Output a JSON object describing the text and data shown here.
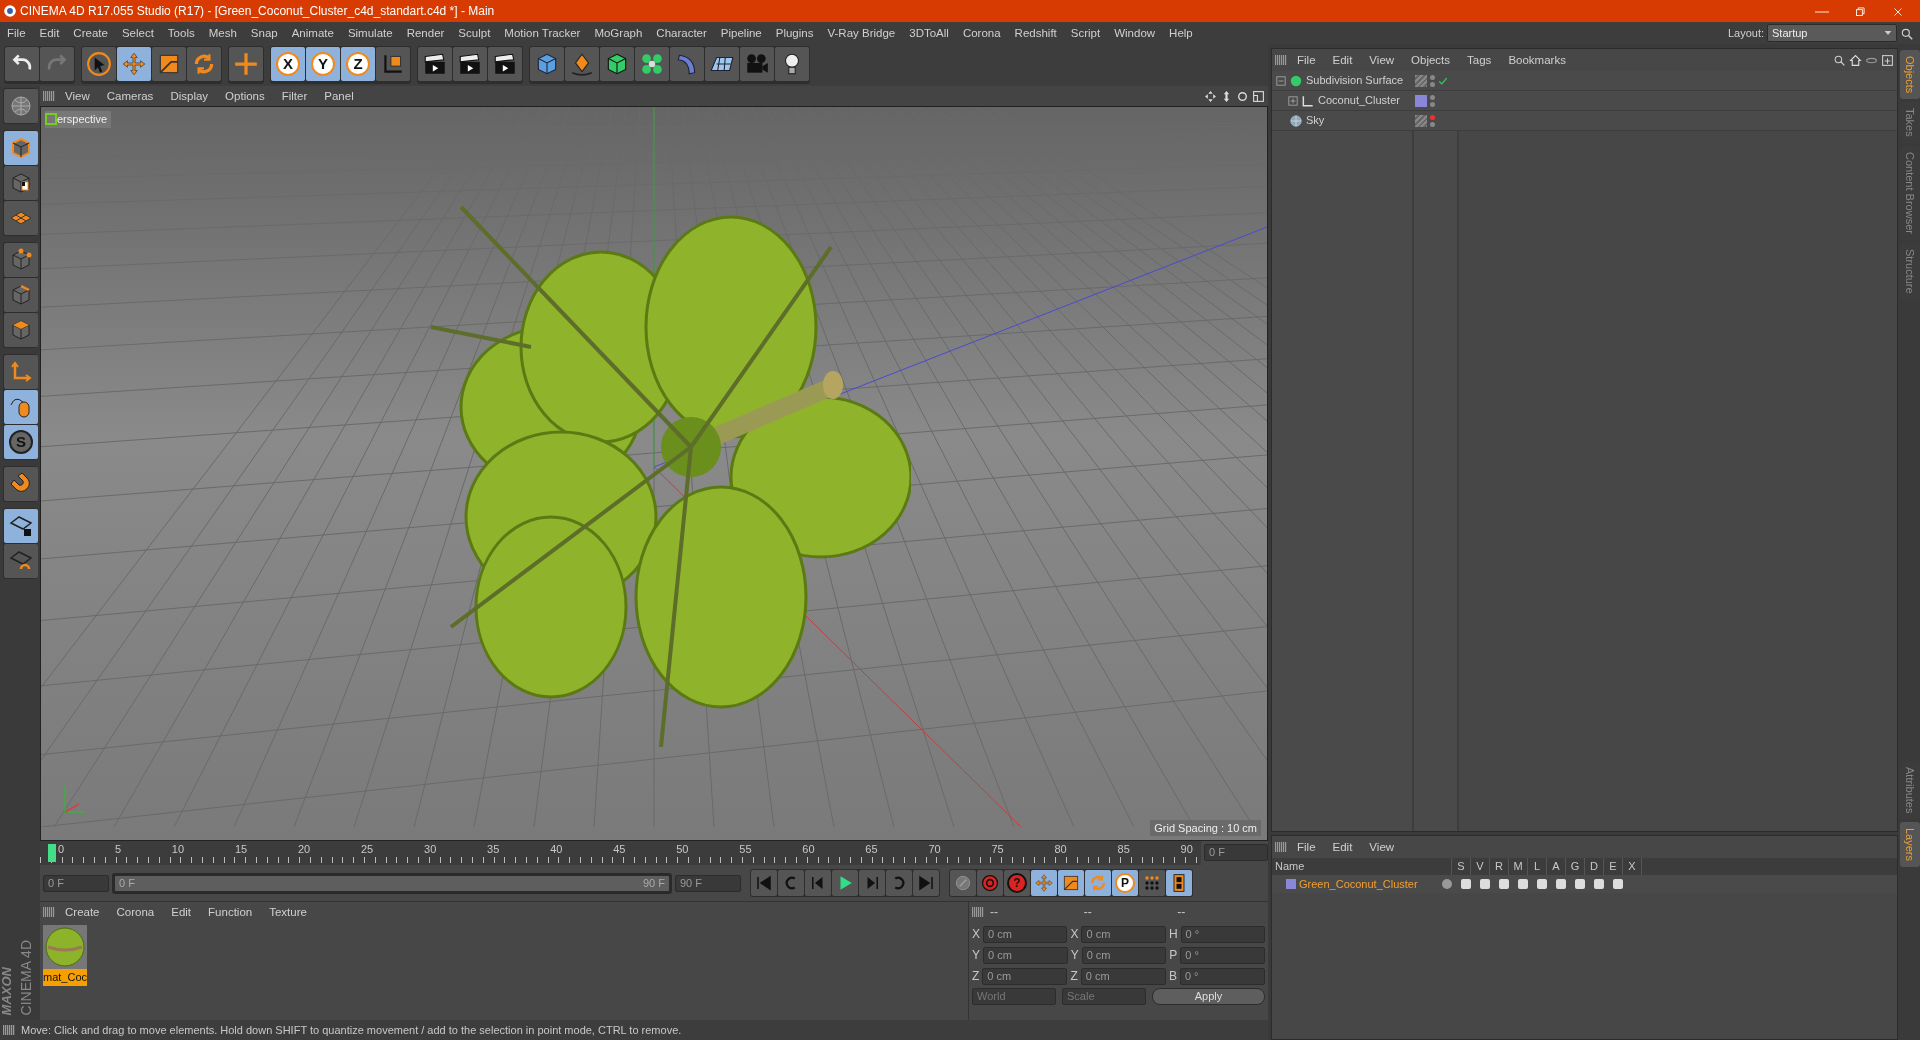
{
  "window": {
    "title": "CINEMA 4D R17.055 Studio (R17) - [Green_Coconut_Cluster_c4d_standart.c4d *] - Main"
  },
  "menu": [
    "File",
    "Edit",
    "Create",
    "Select",
    "Tools",
    "Mesh",
    "Snap",
    "Animate",
    "Simulate",
    "Render",
    "Sculpt",
    "Motion Tracker",
    "MoGraph",
    "Character",
    "Pipeline",
    "Plugins",
    "V-Ray Bridge",
    "3DToAll",
    "Corona",
    "Redshift",
    "Script",
    "Window",
    "Help"
  ],
  "layout": {
    "label": "Layout:",
    "value": "Startup"
  },
  "toolbar": [
    [
      {
        "kind": "undo",
        "selected": false
      },
      {
        "kind": "redo",
        "selected": false
      }
    ],
    [
      {
        "kind": "pointer",
        "selected": false
      },
      {
        "kind": "move",
        "selected": true
      },
      {
        "kind": "scale",
        "selected": false
      },
      {
        "kind": "rotate",
        "selected": false
      }
    ],
    [
      {
        "kind": "multi",
        "selected": false
      }
    ],
    [
      {
        "kind": "axis",
        "label": "X",
        "selected": true
      },
      {
        "kind": "axis",
        "label": "Y",
        "selected": true
      },
      {
        "kind": "axis",
        "label": "Z",
        "selected": true
      },
      {
        "kind": "coord",
        "selected": false
      }
    ],
    [
      {
        "kind": "clapper",
        "selected": false
      },
      {
        "kind": "clapper",
        "selected": false
      },
      {
        "kind": "clapper",
        "selected": false
      }
    ],
    [
      {
        "kind": "cube",
        "selected": false
      },
      {
        "kind": "pen",
        "selected": false
      },
      {
        "kind": "subdiv",
        "selected": false
      },
      {
        "kind": "cloner",
        "selected": false
      },
      {
        "kind": "deformer",
        "selected": false
      },
      {
        "kind": "floor",
        "selected": false
      },
      {
        "kind": "camera",
        "selected": false
      },
      {
        "kind": "light",
        "selected": false
      }
    ]
  ],
  "left_tools": [
    [
      {
        "kind": "globe",
        "selected": false
      }
    ],
    [
      {
        "kind": "model",
        "selected": true
      },
      {
        "kind": "texture",
        "selected": false
      },
      {
        "kind": "workplane",
        "selected": false
      }
    ],
    [
      {
        "kind": "points",
        "selected": false
      },
      {
        "kind": "edges",
        "selected": false
      },
      {
        "kind": "polygons",
        "selected": false
      }
    ],
    [
      {
        "kind": "axes",
        "selected": false
      },
      {
        "kind": "tweak",
        "selected": true
      },
      {
        "kind": "snap",
        "label": "S",
        "selected": true
      }
    ],
    [
      {
        "kind": "magnet",
        "selected": false
      }
    ],
    [
      {
        "kind": "lockgrid",
        "selected": true
      },
      {
        "kind": "gridcycle",
        "selected": false
      }
    ]
  ],
  "viewport": {
    "menu": [
      "View",
      "Cameras",
      "Display",
      "Options",
      "Filter",
      "Panel"
    ],
    "camera_label": "erspective",
    "grid_spacing": "Grid Spacing : 10 cm"
  },
  "timeline": {
    "ticks": [
      "0",
      "5",
      "10",
      "15",
      "20",
      "25",
      "30",
      "35",
      "40",
      "45",
      "50",
      "55",
      "60",
      "65",
      "70",
      "75",
      "80",
      "85",
      "90"
    ],
    "current_frame": "0 F",
    "level": 1,
    "start": "0 F",
    "range_start": "0 F",
    "range_end": "90 F",
    "end": "90 F"
  },
  "timeline_tools": [
    {
      "kind": "keyframe",
      "selected": false
    },
    {
      "kind": "record",
      "selected": false
    },
    {
      "kind": "help",
      "label": "?",
      "selected": false
    },
    {
      "kind": "move",
      "selected": true
    },
    {
      "kind": "scale",
      "selected": true
    },
    {
      "kind": "rotate",
      "selected": true
    },
    {
      "kind": "param",
      "label": "P",
      "selected": true
    },
    {
      "kind": "dots",
      "selected": false
    },
    {
      "kind": "film",
      "selected": true
    }
  ],
  "materials": {
    "menu": [
      "Create",
      "Corona",
      "Edit",
      "Function",
      "Texture"
    ],
    "items": [
      {
        "name": "mat_Coc",
        "selected": true
      }
    ]
  },
  "coordinates": {
    "headers": [
      "--",
      "--",
      "--"
    ],
    "rows": [
      {
        "axis": "X",
        "position": "0 cm",
        "size_axis": "X",
        "size": "0 cm",
        "rot_axis": "H",
        "rotation": "0 °"
      },
      {
        "axis": "Y",
        "position": "0 cm",
        "size_axis": "Y",
        "size": "0 cm",
        "rot_axis": "P",
        "rotation": "0 °"
      },
      {
        "axis": "Z",
        "position": "0 cm",
        "size_axis": "Z",
        "size": "0 cm",
        "rot_axis": "B",
        "rotation": "0 °"
      }
    ],
    "mode": "World",
    "size_mode": "Scale",
    "apply": "Apply"
  },
  "objects": {
    "menu": [
      "File",
      "Edit",
      "View",
      "Objects",
      "Tags",
      "Bookmarks"
    ],
    "tree": [
      {
        "name": "Subdivision Surface",
        "kind": "subdiv",
        "expanded": true,
        "enabled": true,
        "editor_hidden": false,
        "children": [
          {
            "name": "Coconut_Cluster",
            "kind": "null",
            "expanded": false,
            "enabled": false,
            "editor_hidden": false,
            "color": "#8a86d8"
          }
        ]
      },
      {
        "name": "Sky",
        "kind": "sky",
        "enabled": false,
        "editor_hidden": true
      }
    ]
  },
  "layers": {
    "menu": [
      "File",
      "Edit",
      "View"
    ],
    "columns": [
      "Name",
      "S",
      "V",
      "R",
      "M",
      "L",
      "A",
      "G",
      "D",
      "E",
      "X"
    ],
    "rows": [
      {
        "name": "Green_Coconut_Cluster",
        "color": "#8a86d8"
      }
    ]
  },
  "side_tabs_top": [
    {
      "label": "Objects",
      "selected": true
    },
    {
      "label": "Takes",
      "selected": false
    },
    {
      "label": "Content Browser",
      "selected": false
    },
    {
      "label": "Structure",
      "selected": false
    }
  ],
  "side_tabs_bottom": [
    {
      "label": "Attributes",
      "selected": false
    },
    {
      "label": "Layers",
      "selected": true
    }
  ],
  "logo": {
    "brand": "MAXON",
    "product": "CINEMA 4D"
  },
  "status_bar": "Move: Click and drag to move elements. Hold down SHIFT to quantize movement / add to the selection in point mode, CTRL to remove."
}
